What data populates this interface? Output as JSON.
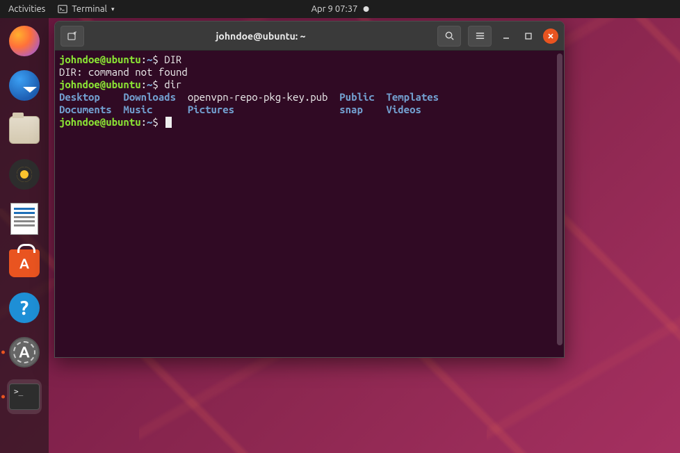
{
  "topbar": {
    "activities": "Activities",
    "app_name": "Terminal",
    "datetime": "Apr 9  07:37"
  },
  "dock": {
    "items": [
      {
        "name": "firefox",
        "label": "Firefox"
      },
      {
        "name": "thunderbird",
        "label": "Thunderbird"
      },
      {
        "name": "files",
        "label": "Files"
      },
      {
        "name": "rhythmbox",
        "label": "Rhythmbox"
      },
      {
        "name": "writer",
        "label": "LibreOffice Writer"
      },
      {
        "name": "software",
        "label": "Ubuntu Software"
      },
      {
        "name": "help",
        "label": "Help"
      },
      {
        "name": "updater",
        "label": "Software Updater"
      },
      {
        "name": "terminal",
        "label": "Terminal"
      }
    ]
  },
  "window": {
    "title": "johndoe@ubuntu: ~",
    "prompt": {
      "user_host": "johndoe@ubuntu",
      "colon": ":",
      "path": "~",
      "symbol": "$"
    },
    "lines": {
      "cmd1": "DIR",
      "err1": "DIR: command not found",
      "cmd2": "dir"
    },
    "listing_row1": {
      "c1": "Desktop",
      "c2": "Downloads",
      "c3": "openvpn-repo-pkg-key.pub",
      "c4": "Public",
      "c5": "Templates"
    },
    "listing_row2": {
      "c1": "Documents",
      "c2": "Music",
      "c3": "Pictures",
      "c4": "snap",
      "c5": "Videos"
    }
  }
}
